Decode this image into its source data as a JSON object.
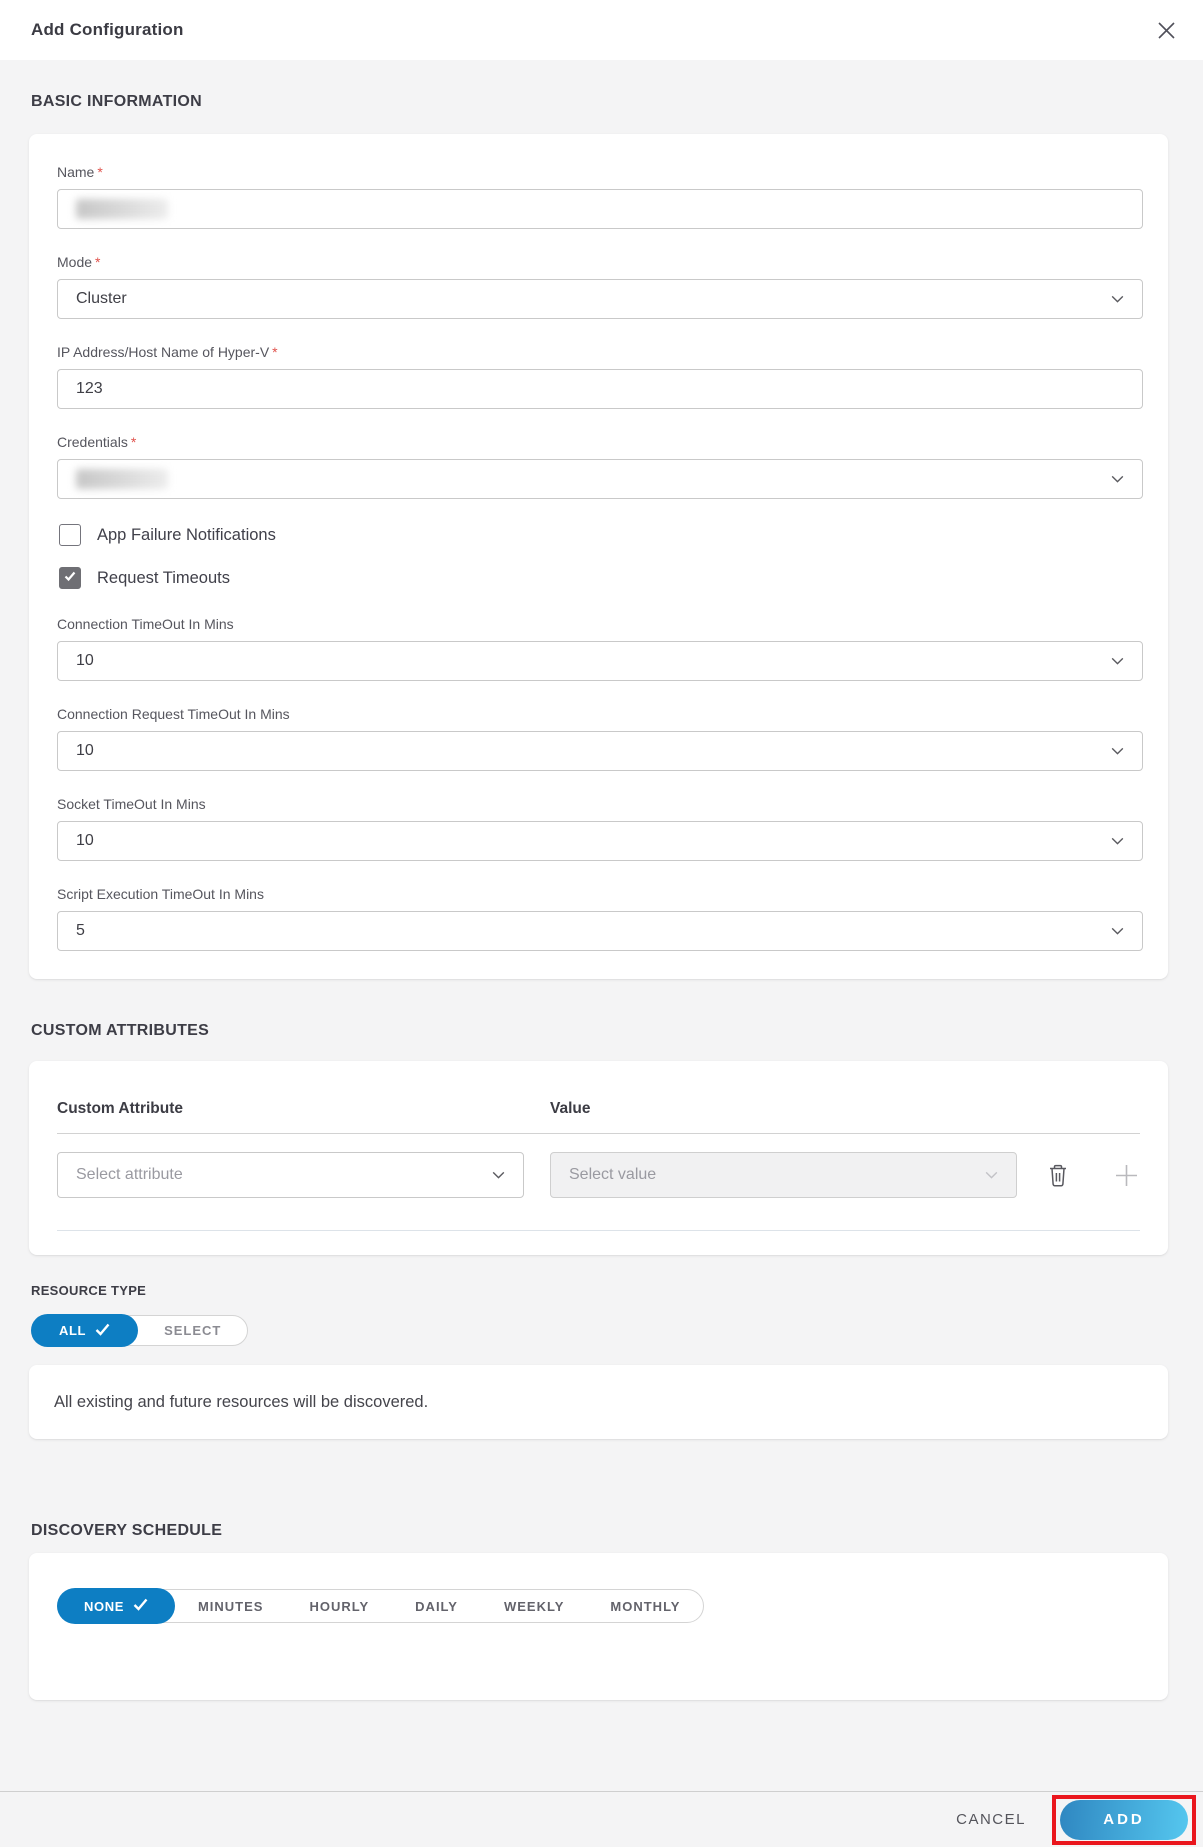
{
  "header": {
    "title": "Add Configuration"
  },
  "basic": {
    "heading": "BASIC INFORMATION",
    "required_mark": "*",
    "name": {
      "label": "Name",
      "value": ""
    },
    "mode": {
      "label": "Mode",
      "value": "Cluster"
    },
    "ip": {
      "label": "IP Address/Host Name of Hyper-V",
      "value": "123"
    },
    "credentials": {
      "label": "Credentials",
      "value": ""
    },
    "checkboxes": {
      "app_failure": {
        "label": "App Failure Notifications",
        "checked": false
      },
      "request_timeouts": {
        "label": "Request Timeouts",
        "checked": true
      }
    },
    "timeouts": {
      "connection": {
        "label": "Connection TimeOut In Mins",
        "value": "10"
      },
      "connection_request": {
        "label": "Connection Request TimeOut In Mins",
        "value": "10"
      },
      "socket": {
        "label": "Socket TimeOut In Mins",
        "value": "10"
      },
      "script_execution": {
        "label": "Script Execution TimeOut In Mins",
        "value": "5"
      }
    }
  },
  "custom_attributes": {
    "heading": "CUSTOM ATTRIBUTES",
    "columns": {
      "attribute": "Custom Attribute",
      "value": "Value"
    },
    "row": {
      "attribute_placeholder": "Select attribute",
      "value_placeholder": "Select value"
    }
  },
  "resource_type": {
    "heading": "RESOURCE TYPE",
    "options": {
      "all": "ALL",
      "select": "SELECT"
    },
    "selected": "ALL",
    "description": "All existing and future resources will be discovered."
  },
  "discovery_schedule": {
    "heading": "DISCOVERY SCHEDULE",
    "options": [
      "NONE",
      "MINUTES",
      "HOURLY",
      "DAILY",
      "WEEKLY",
      "MONTHLY"
    ],
    "selected": "NONE"
  },
  "footer": {
    "cancel_label": "CANCEL",
    "add_label": "ADD"
  },
  "colors": {
    "accent_blue": "#0d7ec3",
    "annotation_red": "#ea161d",
    "required_red": "#e0524c",
    "add_gradient_start": "#2f87c1",
    "add_gradient_end": "#55c7ef",
    "page_background": "#f4f4f5"
  }
}
